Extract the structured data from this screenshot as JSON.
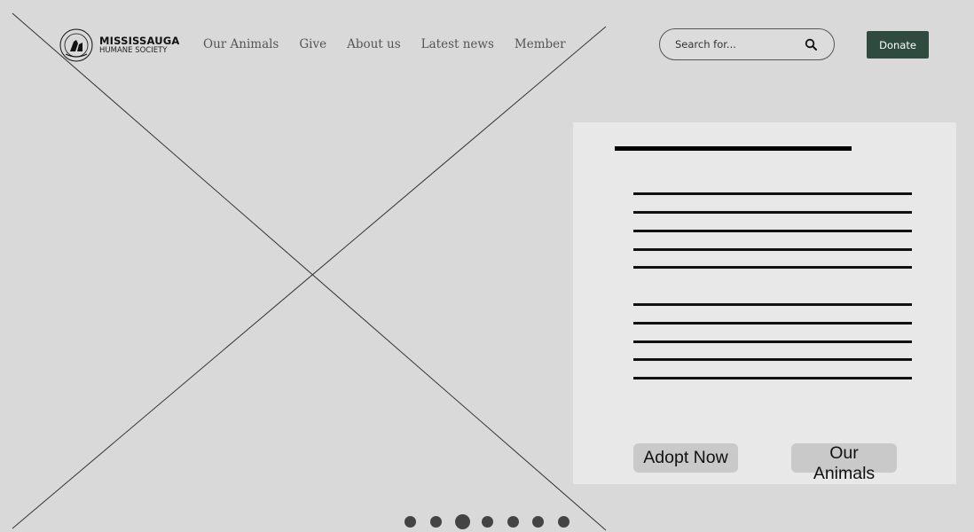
{
  "logo": {
    "line1": "MISSISSAUGA",
    "line2": "HUMANE SOCIETY"
  },
  "nav": {
    "items": [
      {
        "label": "Our Animals"
      },
      {
        "label": "Give"
      },
      {
        "label": "About us"
      },
      {
        "label": "Latest news"
      },
      {
        "label": "Member"
      }
    ]
  },
  "search": {
    "placeholder": "Search for...",
    "icon": "search-icon"
  },
  "donate": {
    "label": "Donate",
    "color": "#2f4a3f"
  },
  "hero": {
    "placeholder_graphic": "image-placeholder-x"
  },
  "panel": {
    "primary_button": "Adopt Now",
    "secondary_button": "Our Animals",
    "background": "#e8e8e8"
  },
  "carousel": {
    "dot_count": 7,
    "active_index": 2,
    "dot_color": "#444444"
  },
  "colors": {
    "page_bg": "#d9d9d9",
    "text_nav": "#555555"
  }
}
